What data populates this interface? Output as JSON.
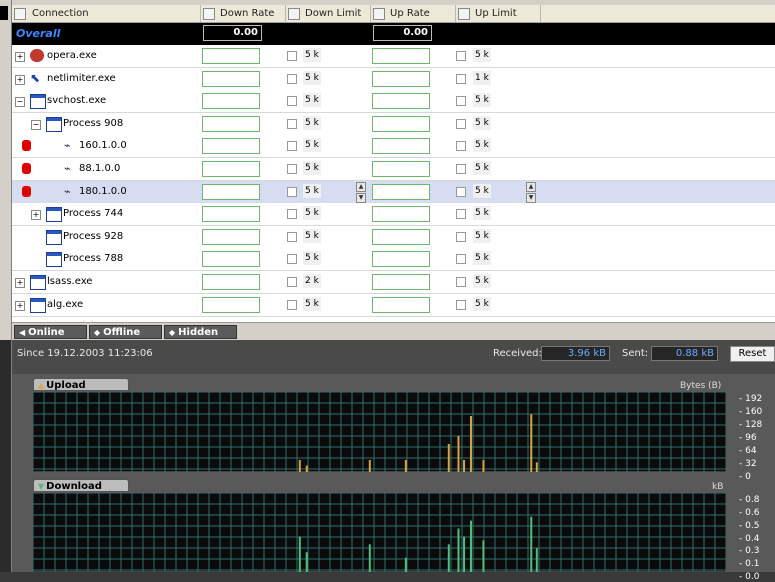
{
  "header": {
    "columns": [
      "Connection",
      "Down Rate",
      "Down Limit",
      "Up Rate",
      "Up Limit"
    ]
  },
  "overall": {
    "label": "Overall",
    "down_rate": "0.00",
    "up_rate": "0.00"
  },
  "rows": [
    {
      "label": "opera.exe",
      "expander": "+",
      "down_limit": "5 k",
      "up_limit": "5 k"
    },
    {
      "label": "netlimiter.exe",
      "expander": "+",
      "down_limit": "5 k",
      "up_limit": "1 k"
    },
    {
      "label": "svchost.exe",
      "expander": "−",
      "down_limit": "5 k",
      "up_limit": "5 k"
    },
    {
      "label": "Process 908",
      "expander": "−",
      "down_limit": "5 k",
      "up_limit": "5 k"
    },
    {
      "label": "160.1.0.0",
      "expander": "",
      "down_limit": "5 k",
      "up_limit": "5 k"
    },
    {
      "label": "88.1.0.0",
      "expander": "",
      "down_limit": "5 k",
      "up_limit": "5 k"
    },
    {
      "label": "180.1.0.0",
      "expander": "",
      "down_limit": "5 k",
      "up_limit": "5 k"
    },
    {
      "label": "Process 744",
      "expander": "+",
      "down_limit": "5 k",
      "up_limit": "5 k"
    },
    {
      "label": "Process 928",
      "expander": "",
      "down_limit": "5 k",
      "up_limit": "5 k"
    },
    {
      "label": "Process 788",
      "expander": "",
      "down_limit": "5 k",
      "up_limit": "5 k"
    },
    {
      "label": "lsass.exe",
      "expander": "+",
      "down_limit": "2 k",
      "up_limit": "5 k"
    },
    {
      "label": "alg.exe",
      "expander": "+",
      "down_limit": "5 k",
      "up_limit": "5 k"
    }
  ],
  "tabs": [
    "Online",
    "Offline",
    "Hidden"
  ],
  "stats": {
    "since": "Since 19.12.2003 11:23:06",
    "received_label": "Received:",
    "received_value": "3.96 kB",
    "sent_label": "Sent:",
    "sent_value": "0.88 kB",
    "reset_label": "Reset"
  },
  "upload": {
    "tab": "Upload",
    "unit": "Bytes (B)",
    "ticks": [
      "192",
      "160",
      "128",
      "96",
      "64",
      "32",
      "0"
    ],
    "color": "#d9a441"
  },
  "download": {
    "tab": "Download",
    "unit": "kB",
    "ticks": [
      "0.8",
      "0.6",
      "0.5",
      "0.4",
      "0.3",
      "0.1",
      "0.0"
    ],
    "color": "#4fbf7f"
  },
  "colors": {
    "overall_text": "#3f86ff",
    "grid": "#2f6f6f",
    "graph_bg": "#0b0b0b"
  }
}
